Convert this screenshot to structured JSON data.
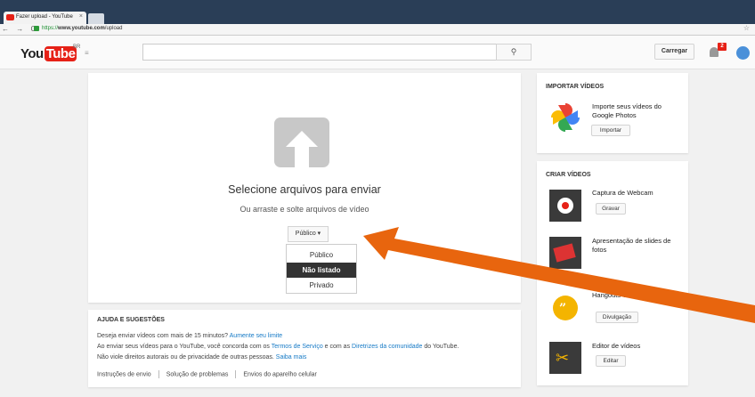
{
  "browser": {
    "tab_title": "Fazer upload - YouTube",
    "tab_close": "×",
    "nav_glyphs": "← → C",
    "url_scheme": "https://",
    "url_host": "www.youtube.com",
    "url_path": "/upload",
    "star_glyph": "☆"
  },
  "masthead": {
    "logo_you": "You",
    "logo_tube": "Tube",
    "country": "BR",
    "guide_glyph": "≡",
    "search_glyph": "⚲",
    "upload_label": "Carregar",
    "notification_count": "2"
  },
  "upload": {
    "title": "Selecione arquivos para enviar",
    "subtitle": "Ou arraste e solte arquivos de vídeo",
    "privacy_label": "Público ▾",
    "privacy_options": [
      "Público",
      "Não listado",
      "Privado"
    ],
    "selected_option": "Não listado"
  },
  "help": {
    "title": "AJUDA E SUGESTÕES",
    "line1_text": "Deseja enviar vídeos com mais de 15 minutos?",
    "line1_link": "Aumente seu limite",
    "line2_a": "Ao enviar seus vídeos para o YouTube, você concorda com os",
    "line2_link1": "Termos de Serviço",
    "line2_b": "e com as",
    "line2_link2": "Diretrizes da comunidade",
    "line2_c": "do YouTube.",
    "line3_text": "Não viole direitos autorais ou de privacidade de outras pessoas.",
    "line3_link": "Saiba mais",
    "links": [
      "Instruções de envio",
      "Solução de problemas",
      "Envios do aparelho celular"
    ]
  },
  "import": {
    "title": "IMPORTAR VÍDEOS",
    "text": "Importe seus vídeos do Google Photos",
    "button": "Importar"
  },
  "create": {
    "title": "CRIAR VÍDEOS",
    "items": [
      {
        "label": "Captura de Webcam",
        "button": "Gravar"
      },
      {
        "label": "Apresentação de slides de fotos",
        "button": ""
      },
      {
        "label": "Hangouts On Air do Google+",
        "button": "Divulgação"
      },
      {
        "label": "Editor de vídeos",
        "button": "Editar"
      }
    ]
  },
  "colors": {
    "youtube_red": "#e62117",
    "annotation_arrow": "#e8650e",
    "link_blue": "#167ac6"
  }
}
